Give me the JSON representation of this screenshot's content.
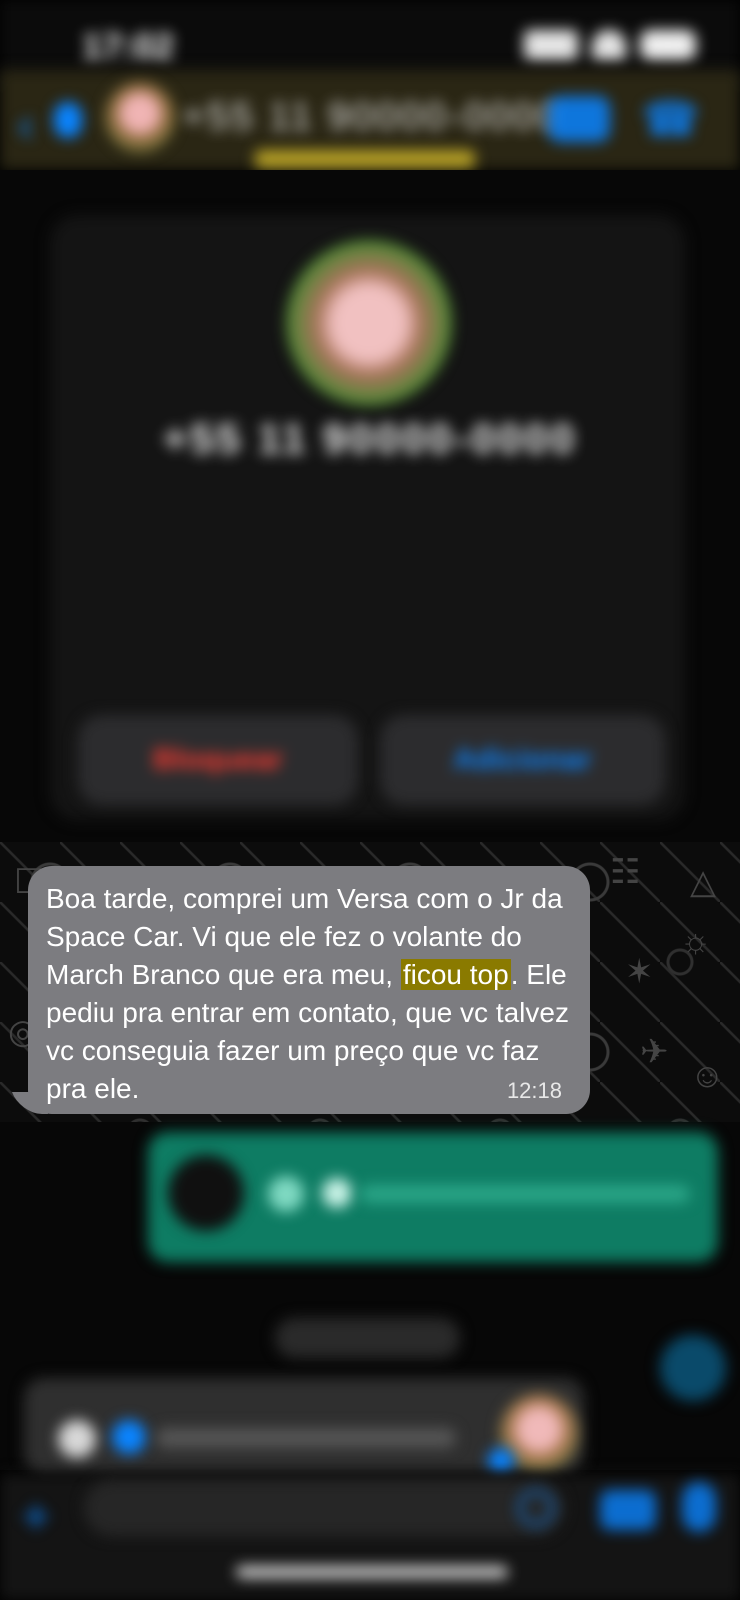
{
  "status_bar": {
    "time": "17:02"
  },
  "header": {
    "back_icon": "chevron-left-icon",
    "contact_name": "+55 11 90000-0000",
    "subtitle": "",
    "video_icon": "video-icon",
    "call_icon": "phone-icon"
  },
  "profile_card": {
    "name": "+55 11 90000-0000",
    "status": "",
    "info": "",
    "safety_link": "",
    "block_label": "Bloquear",
    "add_label": "Adicionar"
  },
  "message": {
    "text_before": "Boa tarde, comprei um Versa com o Jr da Space Car. Vi que ele fez o volante do March Branco que era meu, ",
    "highlight": "ficou top",
    "text_after": ". Ele pediu pra entrar em contato, que vc talvez vc conseguia fazer um preço que vc faz pra ele.",
    "time": "12:18",
    "highlight_color": "#8a7a00"
  },
  "date_chip": "",
  "input_bar": {
    "placeholder": ""
  },
  "colors": {
    "accent": "#0a84ff",
    "outgoing": "#0e7c63",
    "incoming": "#7c7c80"
  }
}
